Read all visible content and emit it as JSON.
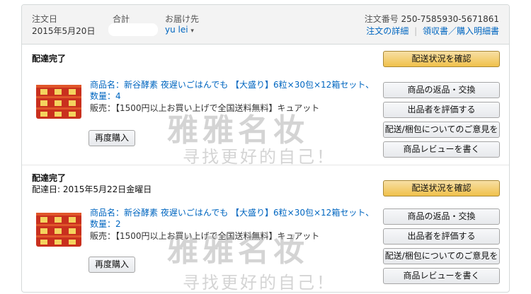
{
  "order": {
    "header": {
      "date_label": "注文日",
      "date_value": "2015年5月20日",
      "total_label": "合計",
      "ship_to_label": "お届け先",
      "ship_to_value": "yu lei",
      "ship_to_caret": "▾",
      "order_no_label": "注文番号",
      "order_no_value": "250-7585930-5671861",
      "details_link": "注文の詳細",
      "separator": "|",
      "receipt_link": "領収書／購入明細書"
    },
    "shipments": [
      {
        "status": "配達完了",
        "delivery_date": "",
        "product_line1": "商品名：新谷酵素 夜遅いごはんでも 【大盛り】6粒×30包×12箱セット、",
        "product_line2": "数量：4",
        "seller": "販売：【1500円以上お買い上げで全国送料無料】キュアット",
        "rebuy": "再度購入",
        "track": "配送状況を確認",
        "return": "商品の返品・交換",
        "rate_seller": "出品者を評価する",
        "feedback": "配送/梱包についてのご意見を",
        "review": "商品レビューを書く"
      },
      {
        "status": "配達完了",
        "delivery_date": "配達日: 2015年5月22日金曜日",
        "product_line1": "商品名：新谷酵素 夜遅いごはんでも 【大盛り】6粒×30包×12箱セット、",
        "product_line2": "数量：2",
        "seller": "販売：【1500円以上お買い上げで全国送料無料】キュアット",
        "rebuy": "再度購入",
        "track": "配送状況を確認",
        "return": "商品の返品・交換",
        "rate_seller": "出品者を評価する",
        "feedback": "配送/梱包についてのご意見を",
        "review": "商品レビューを書く"
      }
    ]
  },
  "watermark": {
    "big": "雅雅名妆",
    "small": "寻找更好的自己！"
  },
  "colors": {
    "link": "#0066c0",
    "primary_button": "#f0c14b",
    "header_bg": "#f3f3f3"
  }
}
